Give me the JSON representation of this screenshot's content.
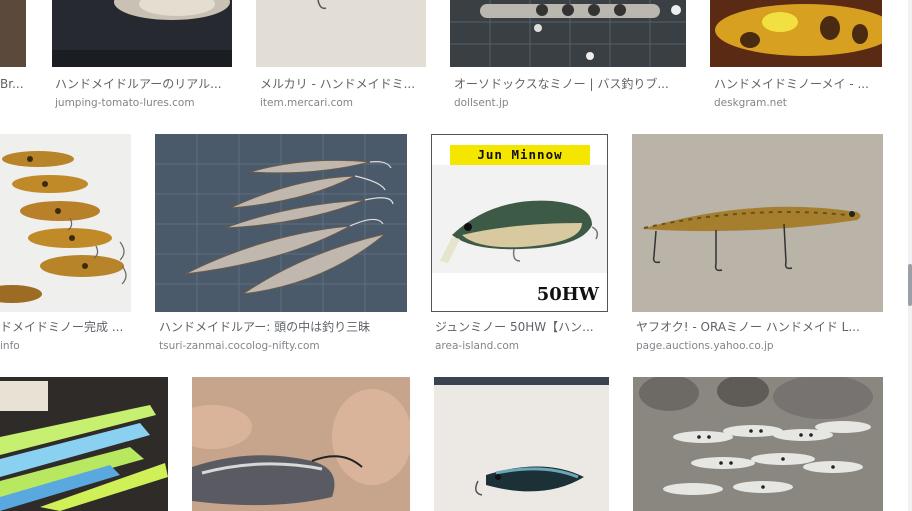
{
  "results": [
    {
      "title": "",
      "domain": ""
    },
    {
      "title": "ハンドメイドルアーのリアル...",
      "domain": "jumping-tomato-lures.com"
    },
    {
      "title": "メルカリ - ハンドメイドミ...",
      "domain": "item.mercari.com"
    },
    {
      "title": "オーソドックスなミノー | バス釣りブ...",
      "domain": "dollsent.jp"
    },
    {
      "title": "ハンドメイドミノーメイ - ...",
      "domain": "deskgram.net"
    },
    {
      "title": "ドメイドミノー完成 ...",
      "domain": "info"
    },
    {
      "title": "ハンドメイドルアー: 頭の中は釣り三昧",
      "domain": "tsuri-zanmai.cocolog-nifty.com"
    },
    {
      "title": "ジュンミノー 50HW【ハン...",
      "domain": "area-island.com"
    },
    {
      "title": "ヤフオク! - ORAミノー ハンドメイド L...",
      "domain": "page.auctions.yahoo.co.jp"
    }
  ],
  "overlay_text": {
    "jun_minnow_banner": "Jun Minnow",
    "jun_minnow_model": "50HW",
    "left_partial_title": "Br..."
  },
  "colors": {
    "title": "#5f6368",
    "domain": "#80868b",
    "banner_yellow": "#f5e600"
  }
}
